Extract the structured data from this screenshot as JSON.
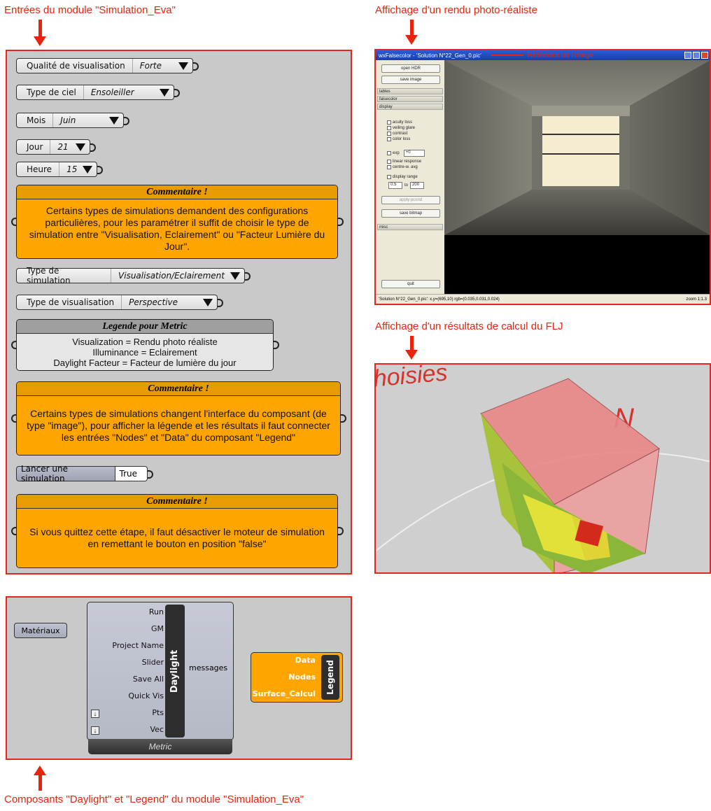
{
  "captions": {
    "inputs": "Entrées du module \"Simulation_Eva\"",
    "render": "Affichage d'un rendu photo-réaliste",
    "flj": "Affichage d'un résultats de calcul du FLJ",
    "components": "Composants \"Daylight\" et \"Legend\" du module \"Simulation_Eva\""
  },
  "inputs": {
    "quality": {
      "label": "Qualité de visualisation",
      "value": "Forte"
    },
    "sky": {
      "label": "Type de ciel",
      "value": "Ensoleiller"
    },
    "month": {
      "label": "Mois",
      "value": "Juin"
    },
    "day": {
      "label": "Jour",
      "value": "21"
    },
    "hour": {
      "label": "Heure",
      "value": "15"
    },
    "comment1": {
      "title": "Commentaire !",
      "text": "Certains types de simulations demandent des configurations particulières, pour les paramétrer il suffit de choisir le type de simulation entre \"Visualisation, Eclairement\" ou \"Facteur Lumière du Jour\"."
    },
    "sim_type": {
      "label": "Type de simulation",
      "value": "Visualisation/Eclairement"
    },
    "vis_type": {
      "label": "Type de visualisation",
      "value": "Perspective"
    },
    "legend_panel": {
      "title": "Legende pour Metric",
      "lines": [
        "Visualization = Rendu photo réaliste",
        "Illuminance = Eclairement",
        "Daylight Facteur = Facteur de lumière du jour"
      ]
    },
    "comment2": {
      "title": "Commentaire !",
      "text": "Certains types de simulations changent l'interface du composant (de type \"image\"), pour afficher la légende et les résultats il faut connecter les entrées \"Nodes\" et \"Data\" du composant \"Legend\""
    },
    "toggle": {
      "label": "Lancer une simulation",
      "value": "True"
    },
    "comment3": {
      "title": "Commentaire !",
      "text": "Si vous quittez cette étape, il faut désactiver le moteur de simulation en remettant le bouton en position \"false\""
    }
  },
  "viewer": {
    "title": "wxFalsecolor - 'Solution N°22_Gen_0.pic'",
    "annotation": "Référence de l'image",
    "buttons": {
      "open": "open HDR",
      "save": "save image",
      "apply": "apply pcond",
      "bitmap": "save bitmap",
      "quit": "quit"
    },
    "sections": {
      "lables": "lables",
      "falsecolor": "falsecolor",
      "display": "display",
      "misc": "misc"
    },
    "checks": [
      "acuity loss",
      "veiling glare",
      "contrast",
      "color loss"
    ],
    "exp_label": "exp",
    "exp_value": "+0",
    "checks2": [
      "linear response",
      "centre-w. avg"
    ],
    "range_label": "display range",
    "range_min": "0.5",
    "range_to": "to",
    "range_max": "200",
    "status": "'Solution N°22_Gen_0.pic':   x,y=(695,10)  rgb=(0.035,0.031,0.024)",
    "zoom": "zoom 1:1.3"
  },
  "flj_view": {
    "compass": "N",
    "partial_text": "choisies"
  },
  "components": {
    "materials_label": "Matériaux",
    "daylight_inputs": [
      "Run",
      "GM",
      "Project Name",
      "Slider",
      "Save All",
      "Quick Vis",
      "Pts",
      "Vec"
    ],
    "daylight_name": "Daylight",
    "daylight_output": "messages",
    "daylight_footer": "Metric",
    "legend_inputs": [
      "Data",
      "Nodes",
      "Surface_Calcul"
    ],
    "legend_name": "Legend"
  },
  "colors": {
    "accent": "#e8240c",
    "comment": "#ffa500",
    "canvas": "#c9c9c9"
  }
}
